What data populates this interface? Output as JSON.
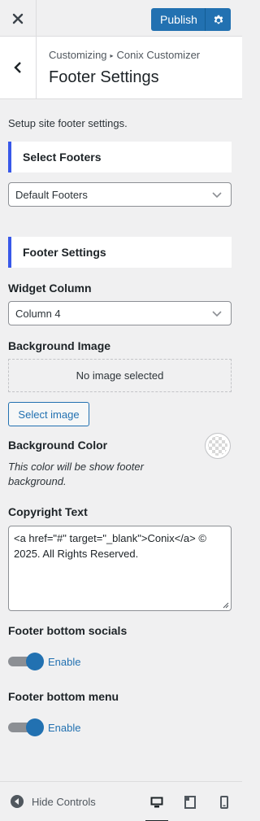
{
  "topbar": {
    "close_icon": "close-icon",
    "publish_label": "Publish",
    "publish_settings_icon": "gear-icon"
  },
  "header": {
    "back_icon": "chevron-left-icon",
    "breadcrumb_parent": "Customizing",
    "breadcrumb_child": "Conix Customizer",
    "title": "Footer Settings"
  },
  "panel": {
    "description": "Setup site footer settings.",
    "select_footers": {
      "heading": "Select Footers",
      "value": "Default Footers"
    },
    "footer_settings": {
      "heading": "Footer Settings",
      "widget_column_label": "Widget Column",
      "widget_column_value": "Column 4",
      "background_image_label": "Background Image",
      "no_image_text": "No image selected",
      "select_image_label": "Select image",
      "background_color_label": "Background Color",
      "background_color_desc": "This color will be show footer background.",
      "copyright_label": "Copyright Text",
      "copyright_value": "<a href=\"#\" target=\"_blank\">Conix</a> © 2025. All Rights Reserved.",
      "socials_label": "Footer bottom socials",
      "socials_toggle_label": "Enable",
      "socials_enabled": true,
      "menu_label": "Footer bottom menu",
      "menu_toggle_label": "Enable",
      "menu_enabled": true
    }
  },
  "footer": {
    "hide_controls_label": "Hide Controls",
    "devices": [
      "desktop",
      "tablet",
      "mobile"
    ],
    "active_device": "desktop"
  },
  "colors": {
    "accent": "#2271b1",
    "section_marker": "#3858e9",
    "background": "#f0f0f1"
  }
}
